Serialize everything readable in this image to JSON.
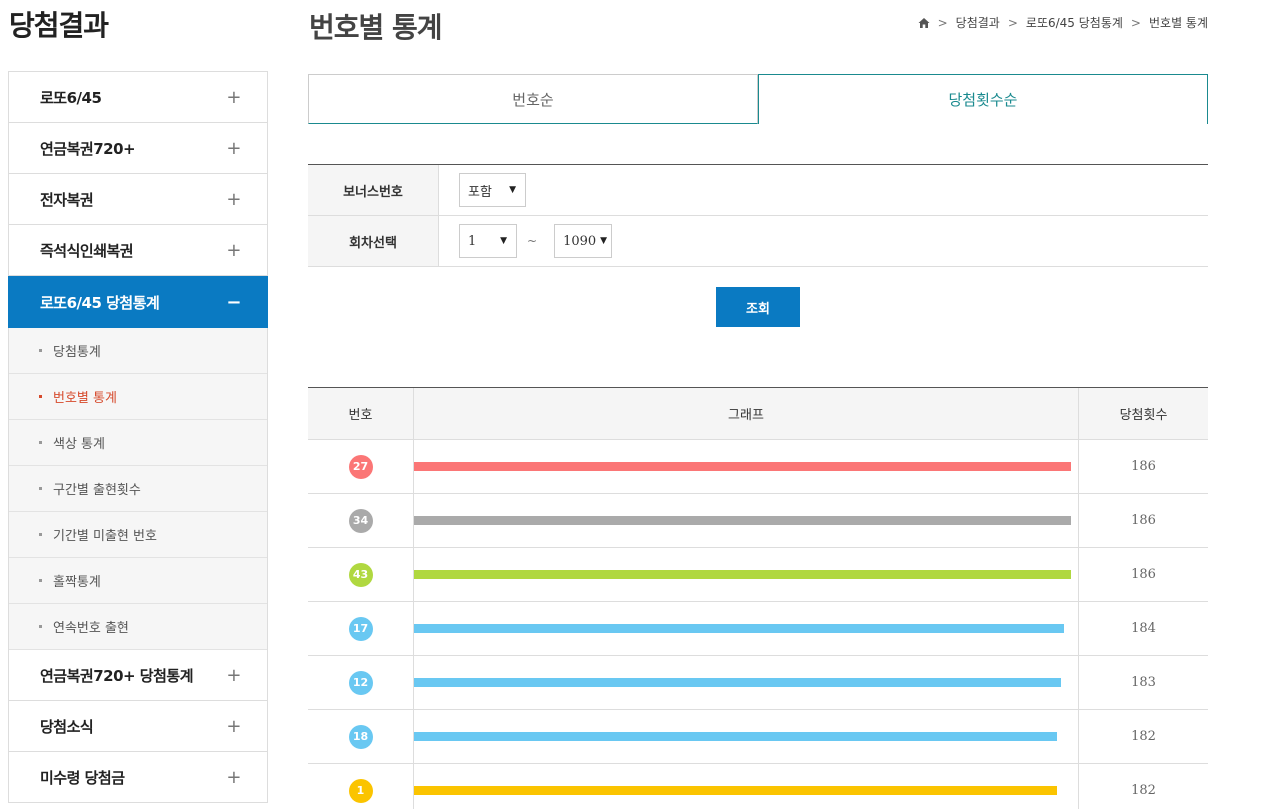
{
  "page_heading": "당첨결과",
  "sidebar": {
    "items": [
      {
        "label": "로또6/45",
        "toggle": "+"
      },
      {
        "label": "연금복권720+",
        "toggle": "+"
      },
      {
        "label": "전자복권",
        "toggle": "+"
      },
      {
        "label": "즉석식인쇄복권",
        "toggle": "+"
      }
    ],
    "active": {
      "label": "로또6/45 당첨통계",
      "toggle": "−"
    },
    "sub_items": [
      "당첨통계",
      "번호별 통계",
      "색상 통계",
      "구간별 출현횟수",
      "기간별 미출현 번호",
      "홀짝통계",
      "연속번호 출현"
    ],
    "current_sub": 1,
    "items_after": [
      {
        "label": "연금복권720+ 당첨통계",
        "toggle": "+"
      },
      {
        "label": "당첨소식",
        "toggle": "+"
      },
      {
        "label": "미수령 당첨금",
        "toggle": "+"
      }
    ]
  },
  "title": "번호별 통계",
  "breadcrumb": [
    "당첨결과",
    "로또6/45 당첨통계",
    "번호별 통계"
  ],
  "breadcrumb_sep": ">",
  "tabs": [
    {
      "label": "번호순",
      "active": false
    },
    {
      "label": "당첨횟수순",
      "active": true
    }
  ],
  "filter": {
    "bonus_label": "보너스번호",
    "bonus_value": "포함",
    "round_label": "회차선택",
    "round_from": "1",
    "round_to": "1090",
    "tilde": "~",
    "arrow": "▼"
  },
  "search_button": "조회",
  "table": {
    "headers": [
      "번호",
      "그래프",
      "당첨횟수"
    ],
    "max_count": 186,
    "rows": [
      {
        "number": "27",
        "count": "186",
        "color": "#fb7676"
      },
      {
        "number": "34",
        "count": "186",
        "color": "#aaaaaa"
      },
      {
        "number": "43",
        "count": "186",
        "color": "#b0d840"
      },
      {
        "number": "17",
        "count": "184",
        "color": "#69c8f2"
      },
      {
        "number": "12",
        "count": "183",
        "color": "#69c8f2"
      },
      {
        "number": "18",
        "count": "182",
        "color": "#69c8f2"
      },
      {
        "number": "1",
        "count": "182",
        "color": "#fbc400"
      }
    ]
  }
}
